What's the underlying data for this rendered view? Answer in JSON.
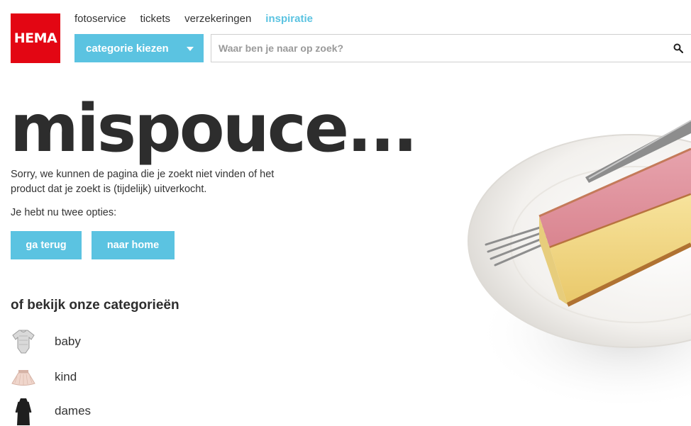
{
  "logo": {
    "text": "HEMA",
    "color": "#e30613"
  },
  "topnav": [
    {
      "label": "fotoservice",
      "active": false
    },
    {
      "label": "tickets",
      "active": false
    },
    {
      "label": "verzekeringen",
      "active": false
    },
    {
      "label": "inspiratie",
      "active": true
    }
  ],
  "category_select": {
    "label": "categorie kiezen",
    "icon": "caret-down-icon"
  },
  "search": {
    "placeholder": "Waar ben je naar op zoek?",
    "value": "",
    "icon": "search-icon"
  },
  "headline": "mispouce...",
  "message": "Sorry, we kunnen de pagina die je zoekt niet vinden of het product dat je zoekt is (tijdelijk) uitverkocht.",
  "options_text": "Je hebt nu twee opties:",
  "buttons": {
    "back": "ga terug",
    "home": "naar home"
  },
  "categories_title": "of bekijk onze categorieën",
  "categories": [
    {
      "label": "baby",
      "icon": "baby-bodysuit-icon"
    },
    {
      "label": "kind",
      "icon": "tutu-skirt-icon"
    },
    {
      "label": "dames",
      "icon": "dress-icon"
    }
  ],
  "hero": {
    "subject": "tompouce-on-plate-image"
  },
  "colors": {
    "accent": "#5bc3e1",
    "brand": "#e30613",
    "text": "#333333"
  }
}
